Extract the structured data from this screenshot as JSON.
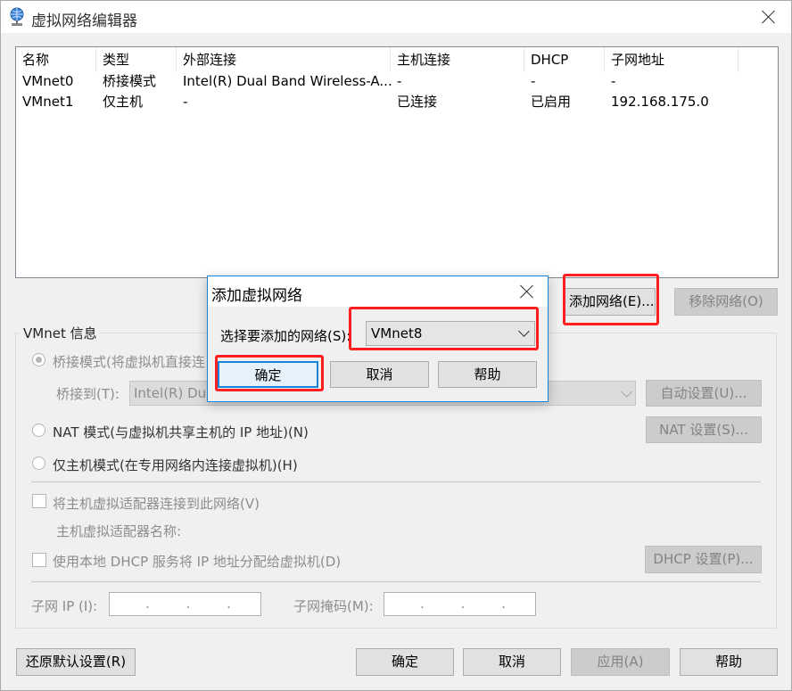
{
  "window": {
    "title": "虚拟网络编辑器"
  },
  "table": {
    "columns": [
      "名称",
      "类型",
      "外部连接",
      "主机连接",
      "DHCP",
      "子网地址"
    ],
    "rows": [
      [
        "VMnet0",
        "桥接模式",
        "Intel(R) Dual Band Wireless-A...",
        "-",
        "-",
        "-"
      ],
      [
        "VMnet1",
        "仅主机",
        "-",
        "已连接",
        "已启用",
        "192.168.175.0"
      ]
    ]
  },
  "actions": {
    "add_network": "添加网络(E)...",
    "remove_network": "移除网络(O)"
  },
  "vmnet_info": {
    "group_title": "VMnet 信息",
    "bridged_label": "桥接模式(将虚拟机直接连",
    "bridged_to_label": "桥接到(T):",
    "bridged_to_value": "Intel(R) Dua",
    "auto_settings": "自动设置(U)...",
    "nat_label": "NAT 模式(与虚拟机共享主机的 IP 地址)(N)",
    "nat_settings": "NAT 设置(S)...",
    "host_only_label": "仅主机模式(在专用网络内连接虚拟机)(H)",
    "connect_adapter_label": "将主机虚拟适配器连接到此网络(V)",
    "adapter_name_label": "主机虚拟适配器名称:",
    "use_dhcp_label": "使用本地 DHCP 服务将 IP 地址分配给虚拟机(D)",
    "dhcp_settings": "DHCP 设置(P)...",
    "subnet_ip_label": "子网 IP (I):",
    "subnet_mask_label": "子网掩码(M):",
    "ip_placeholder": " .  .  . "
  },
  "footer": {
    "restore_defaults": "还原默认设置(R)",
    "ok": "确定",
    "cancel": "取消",
    "apply": "应用(A)",
    "help": "帮助"
  },
  "dialog": {
    "title": "添加虚拟网络",
    "select_label": "选择要添加的网络(S):",
    "selected": "VMnet8",
    "ok": "确定",
    "cancel": "取消",
    "help": "帮助"
  },
  "colors": {
    "highlight": "#ff1f1f",
    "focus_border": "#1883d7"
  }
}
